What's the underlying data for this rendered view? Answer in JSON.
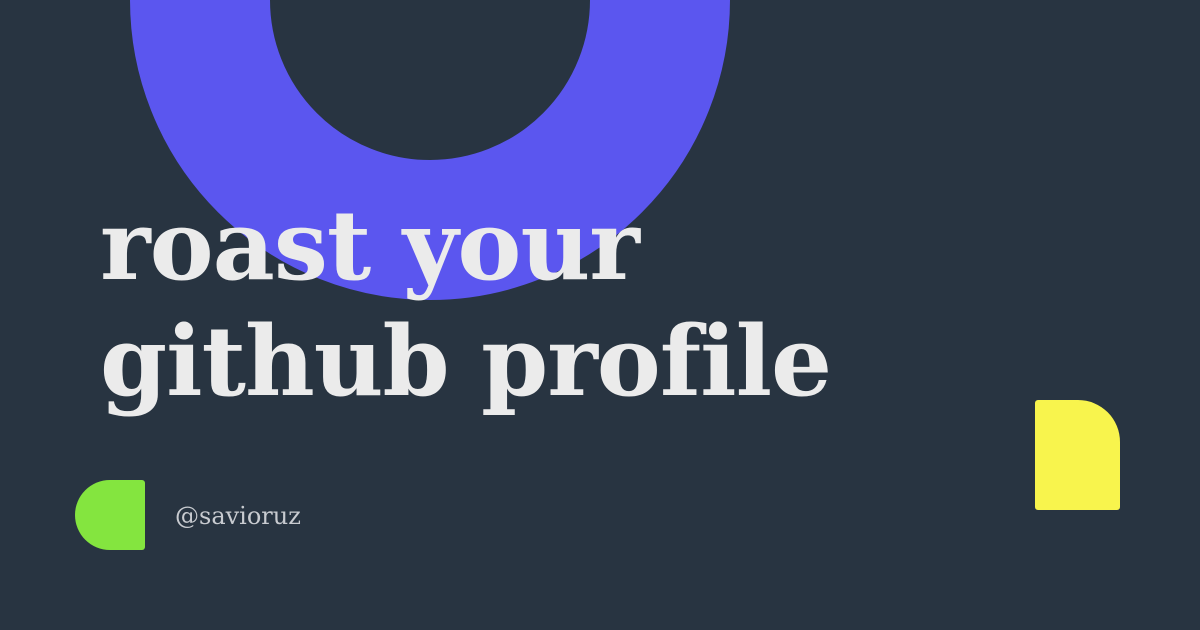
{
  "headline": {
    "line1": "roast your",
    "line2": "github profile"
  },
  "handle": "@savioruz",
  "colors": {
    "background": "#283441",
    "ring": "#5b56ef",
    "headline_text": "#ebebeb",
    "handle_text": "#c8cbd0",
    "green_accent": "#84e53f",
    "yellow_accent": "#f8f44d"
  }
}
